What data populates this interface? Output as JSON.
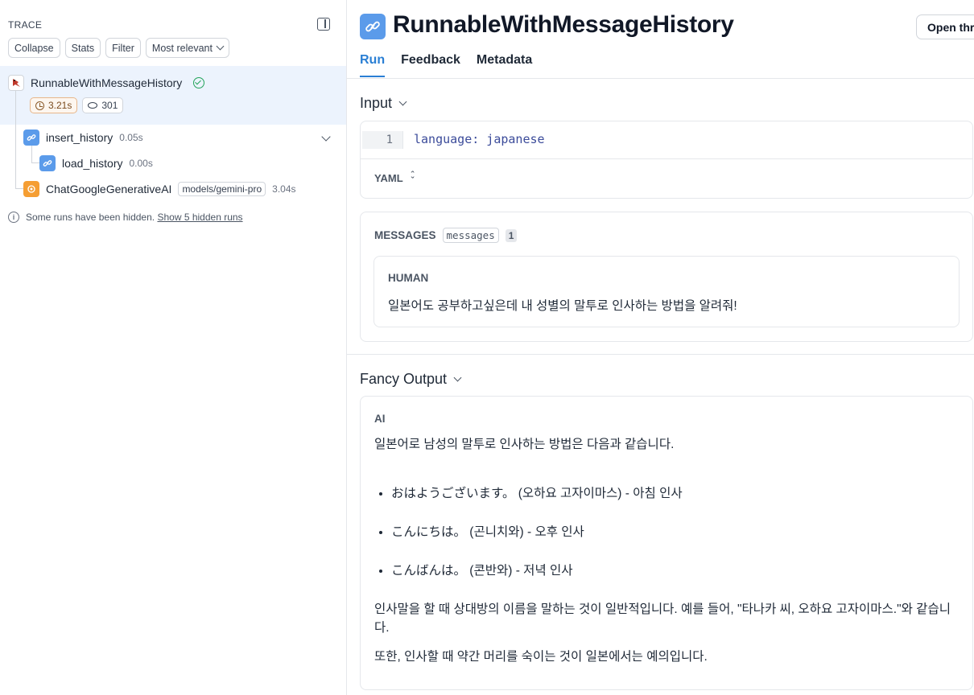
{
  "sidebar": {
    "header": "TRACE",
    "buttons": {
      "collapse": "Collapse",
      "stats": "Stats",
      "filter": "Filter",
      "sort": "Most relevant"
    },
    "root": {
      "name": "RunnableWithMessageHistory",
      "latency": "3.21s",
      "tokens": "301",
      "status": "success"
    },
    "children": [
      {
        "name": "insert_history",
        "duration": "0.05s",
        "icon": "link-icon"
      },
      {
        "name": "load_history",
        "duration": "0.00s",
        "icon": "link-icon"
      },
      {
        "name": "ChatGoogleGenerativeAI",
        "model": "models/gemini-pro",
        "duration": "3.04s",
        "icon": "llm-icon"
      }
    ],
    "hidden_note": "Some runs have been hidden.",
    "hidden_link": "Show 5 hidden runs"
  },
  "main": {
    "title": "RunnableWithMessageHistory",
    "open_button": "Open thread",
    "tabs": [
      "Run",
      "Feedback",
      "Metadata"
    ],
    "input": {
      "heading": "Input",
      "line_number": "1",
      "code": "language: japanese",
      "format": "YAML"
    },
    "messages": {
      "label": "MESSAGES",
      "key": "messages",
      "count": "1",
      "role": "HUMAN",
      "text": "일본어도 공부하고싶은데 내 성별의 말투로 인사하는 방법을 알려줘!"
    },
    "output": {
      "heading": "Fancy Output",
      "role": "AI",
      "intro": "일본어로 남성의 말투로 인사하는 방법은 다음과 같습니다.",
      "items": [
        "おはようございます。 (오하요 고자이마스) - 아침 인사",
        "こんにちは。 (곤니치와) - 오후 인사",
        "こんばんは。 (콘반와) - 저녁 인사"
      ],
      "para1": "인사말을 할 때 상대방의 이름을 말하는 것이 일반적입니다. 예를 들어, \"타나카 씨, 오하요 고자이마스.\"와 같습니다.",
      "para2": "또한, 인사할 때 약간 머리를 숙이는 것이 일본에서는 예의입니다."
    }
  },
  "colors": {
    "accent": "#2a7fd4",
    "selected_row": "#ecf3fd",
    "link_icon": "#5b9bea",
    "llm_icon": "#f59e33",
    "success": "#22a35a"
  }
}
